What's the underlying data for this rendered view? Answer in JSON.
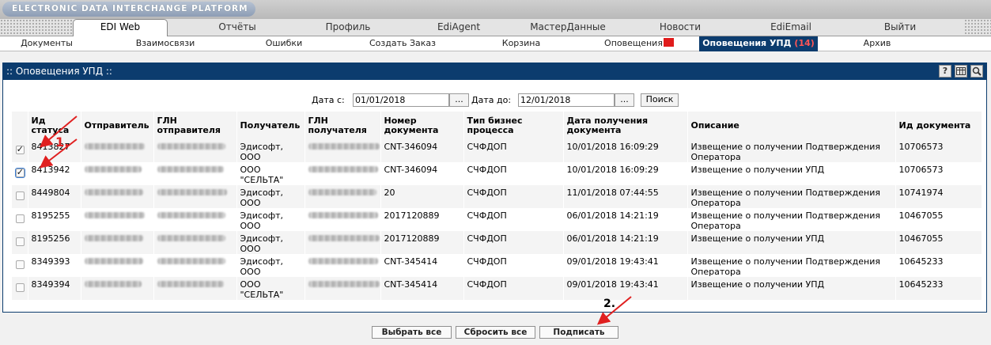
{
  "app": {
    "platform_title": "ELECTRONIC DATA INTERCHANGE PLATFORM"
  },
  "main_tabs": [
    "EDI Web",
    "Отчёты",
    "Профиль",
    "EdiAgent",
    "МастерДанные",
    "Новости",
    "EdiEmail",
    "Выйти"
  ],
  "sub_tabs": {
    "documents": "Документы",
    "relations": "Взаимосвязи",
    "errors": "Ошибки",
    "create_order": "Создать Заказ",
    "cart": "Корзина",
    "notifications": "Оповещения",
    "upd_notifications": "Оповещения УПД",
    "upd_count": "(14)",
    "archive": "Архив"
  },
  "panel": {
    "title": ":: Оповещения УПД ::",
    "icons": [
      "help-icon",
      "table-icon",
      "search-icon"
    ]
  },
  "filter": {
    "date_from_label": "Дата с:",
    "date_from": "01/01/2018",
    "date_to_label": "Дата до:",
    "date_to": "12/01/2018",
    "picker_label": "...",
    "search_label": "Поиск"
  },
  "table": {
    "headers": [
      "",
      "Ид статуса",
      "Отправитель",
      "ГЛН отправителя",
      "Получатель",
      "ГЛН получателя",
      "Номер документа",
      "Тип бизнес процесса",
      "Дата получения документа",
      "Описание",
      "Ид документа"
    ],
    "rows": [
      {
        "checked": true,
        "status_id": "8413827",
        "recipient": "Эдисофт, ООО",
        "doc_number": "CNT-346094",
        "process": "СЧФДОП",
        "date": "10/01/2018 16:09:29",
        "description": "Извещение о получении Подтверждения Оператора",
        "doc_id": "10706573"
      },
      {
        "checked": true,
        "status_id": "8413942",
        "recipient": "ООО \"СЕЛЬТА\"",
        "doc_number": "CNT-346094",
        "process": "СЧФДОП",
        "date": "10/01/2018 16:09:29",
        "description": "Извещение о получении УПД",
        "doc_id": "10706573"
      },
      {
        "checked": false,
        "status_id": "8449804",
        "recipient": "Эдисофт, ООО",
        "doc_number": "20",
        "process": "СЧФДОП",
        "date": "11/01/2018 07:44:55",
        "description": "Извещение о получении Подтверждения Оператора",
        "doc_id": "10741974"
      },
      {
        "checked": false,
        "status_id": "8195255",
        "recipient": "Эдисофт, ООО",
        "doc_number": "2017120889",
        "process": "СЧФДОП",
        "date": "06/01/2018 14:21:19",
        "description": "Извещение о получении Подтверждения Оператора",
        "doc_id": "10467055"
      },
      {
        "checked": false,
        "status_id": "8195256",
        "recipient": "Эдисофт, ООО",
        "doc_number": "2017120889",
        "process": "СЧФДОП",
        "date": "06/01/2018 14:21:19",
        "description": "Извещение о получении УПД",
        "doc_id": "10467055"
      },
      {
        "checked": false,
        "status_id": "8349393",
        "recipient": "Эдисофт, ООО",
        "doc_number": "CNT-345414",
        "process": "СЧФДОП",
        "date": "09/01/2018 19:43:41",
        "description": "Извещение о получении Подтверждения Оператора",
        "doc_id": "10645233"
      },
      {
        "checked": false,
        "status_id": "8349394",
        "recipient": "ООО \"СЕЛЬТА\"",
        "doc_number": "CNT-345414",
        "process": "СЧФДОП",
        "date": "09/01/2018 19:43:41",
        "description": "Извещение о получении УПД",
        "doc_id": "10645233"
      }
    ]
  },
  "actions": {
    "select_all": "Выбрать все",
    "reset_all": "Сбросить все",
    "sign": "Подписать"
  },
  "annotations": {
    "step1": "1.",
    "step2": "2.",
    "arrow_color": "#e02020"
  }
}
